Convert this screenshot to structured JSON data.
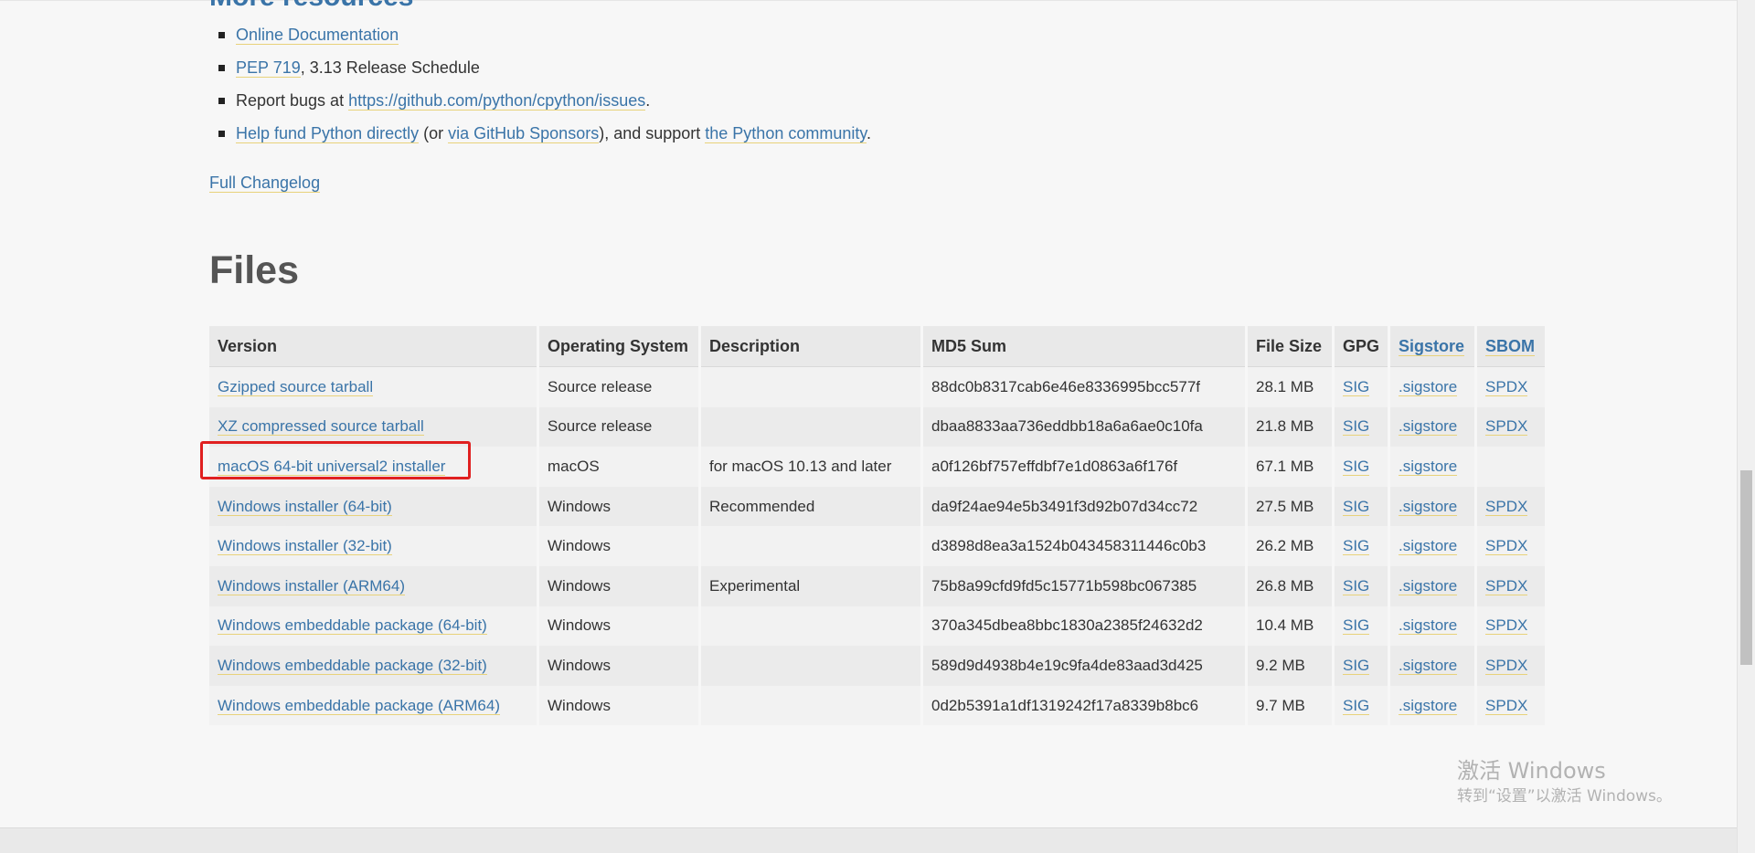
{
  "resources": {
    "heading": "More resources",
    "items": [
      {
        "link1": "Online Documentation"
      },
      {
        "link1": "PEP 719",
        "text1": ", 3.13 Release Schedule"
      },
      {
        "text0": "Report bugs at ",
        "link1": "https://github.com/python/cpython/issues",
        "text1": "."
      },
      {
        "link1": "Help fund Python directly",
        "text1": " (or ",
        "link2": "via GitHub Sponsors",
        "text2": "), and support ",
        "link3": "the Python community",
        "text3": "."
      }
    ]
  },
  "changelog_label": "Full Changelog",
  "files": {
    "title": "Files",
    "headers": {
      "version": "Version",
      "os": "Operating System",
      "description": "Description",
      "md5": "MD5 Sum",
      "size": "File Size",
      "gpg": "GPG",
      "sigstore": "Sigstore",
      "sbom": "SBOM"
    },
    "rows": [
      {
        "version": "Gzipped source tarball",
        "os": "Source release",
        "description": "",
        "md5": "88dc0b8317cab6e46e8336995bcc577f",
        "size": "28.1 MB",
        "gpg": "SIG",
        "sigstore": ".sigstore",
        "sbom": "SPDX"
      },
      {
        "version": "XZ compressed source tarball",
        "os": "Source release",
        "description": "",
        "md5": "dbaa8833aa736eddbb18a6a6ae0c10fa",
        "size": "21.8 MB",
        "gpg": "SIG",
        "sigstore": ".sigstore",
        "sbom": "SPDX"
      },
      {
        "version": "macOS 64-bit universal2 installer",
        "os": "macOS",
        "description": "for macOS 10.13 and later",
        "md5": "a0f126bf757effdbf7e1d0863a6f176f",
        "size": "67.1 MB",
        "gpg": "SIG",
        "sigstore": ".sigstore",
        "sbom": ""
      },
      {
        "version": "Windows installer (64-bit)",
        "os": "Windows",
        "description": "Recommended",
        "md5": "da9f24ae94e5b3491f3d92b07d34cc72",
        "size": "27.5 MB",
        "gpg": "SIG",
        "sigstore": ".sigstore",
        "sbom": "SPDX"
      },
      {
        "version": "Windows installer (32-bit)",
        "os": "Windows",
        "description": "",
        "md5": "d3898d8ea3a1524b043458311446c0b3",
        "size": "26.2 MB",
        "gpg": "SIG",
        "sigstore": ".sigstore",
        "sbom": "SPDX"
      },
      {
        "version": "Windows installer (ARM64)",
        "os": "Windows",
        "description": "Experimental",
        "md5": "75b8a99cfd9fd5c15771b598bc067385",
        "size": "26.8 MB",
        "gpg": "SIG",
        "sigstore": ".sigstore",
        "sbom": "SPDX"
      },
      {
        "version": "Windows embeddable package (64-bit)",
        "os": "Windows",
        "description": "",
        "md5": "370a345dbea8bbc1830a2385f24632d2",
        "size": "10.4 MB",
        "gpg": "SIG",
        "sigstore": ".sigstore",
        "sbom": "SPDX"
      },
      {
        "version": "Windows embeddable package (32-bit)",
        "os": "Windows",
        "description": "",
        "md5": "589d9d4938b4e19c9fa4de83aad3d425",
        "size": "9.2 MB",
        "gpg": "SIG",
        "sigstore": ".sigstore",
        "sbom": "SPDX"
      },
      {
        "version": "Windows embeddable package (ARM64)",
        "os": "Windows",
        "description": "",
        "md5": "0d2b5391a1df1319242f17a8339b8bc6",
        "size": "9.7 MB",
        "gpg": "SIG",
        "sigstore": ".sigstore",
        "sbom": "SPDX"
      }
    ]
  },
  "watermark": {
    "line1": "激活 Windows",
    "line2": "转到“设置”以激活 Windows。"
  },
  "colors": {
    "link": "#3a74a8",
    "link_underline": "#e8d27a",
    "highlight_box": "#e02020"
  }
}
